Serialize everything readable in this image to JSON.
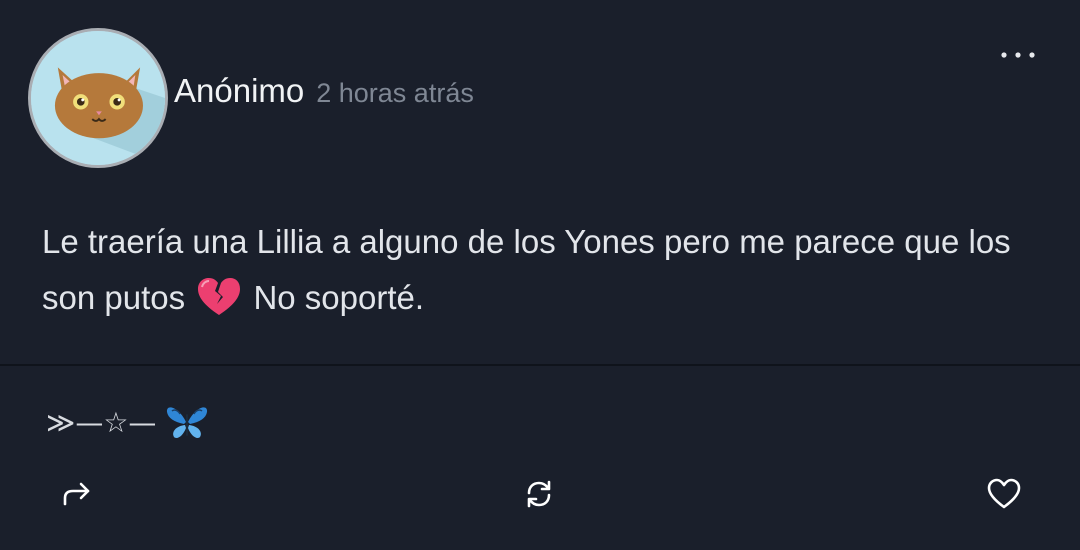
{
  "post": {
    "author": "Anónimo",
    "timestamp": "2 horas atrás",
    "body_line1": "Le traería una Lillia a alguno de los Yones pero me parece que los",
    "body_line2_before": "son putos",
    "body_line2_after": "No soporté.",
    "inline_emoji": "broken-heart-icon"
  },
  "signature": {
    "prefix": "≫—☆—",
    "emoji": "butterfly-icon"
  },
  "icons": {
    "avatar": "cat-face-icon",
    "menu": "more-options-icon",
    "share": "share-arrow-icon",
    "repost": "repost-icon",
    "like": "heart-outline-icon"
  },
  "colors": {
    "background": "#1a1f2b",
    "text": "#e2e5ea",
    "muted": "#7f8794",
    "avatar_bg": "#b9e2ee",
    "avatar_cat": "#b5793b"
  }
}
